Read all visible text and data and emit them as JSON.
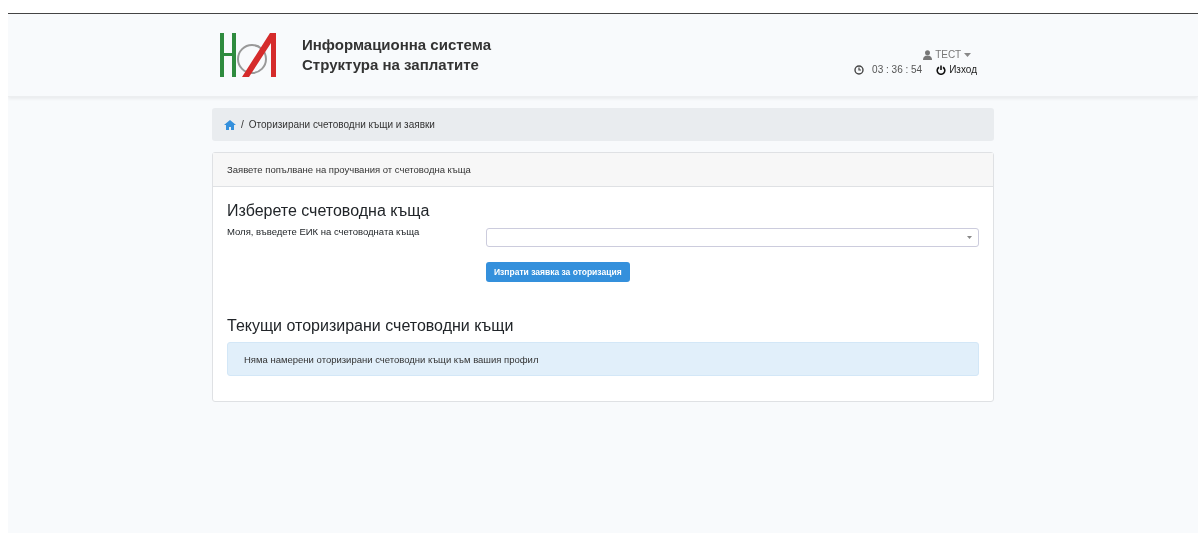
{
  "header": {
    "title_lines": [
      "Информационна система",
      "Структура на заплатите"
    ],
    "user": "ТЕСТ",
    "clock": "03 : 36 : 54",
    "logout": "Изход"
  },
  "breadcrumb": {
    "separator": "/",
    "current": "Оторизирани счетоводни къщи и заявки"
  },
  "card": {
    "header": "Заявете попълване на проучвания от счетоводна къща",
    "select_section": {
      "title": "Изберете счетоводна къща",
      "label": "Моля, въведете ЕИК на счетоводната къща",
      "button": "Изпрати заявка за оторизация"
    },
    "current_section": {
      "title": "Текущи оторизирани счетоводни къщи",
      "alert": "Няма намерени оторизирани счетоводни къщи към вашия профил"
    }
  }
}
